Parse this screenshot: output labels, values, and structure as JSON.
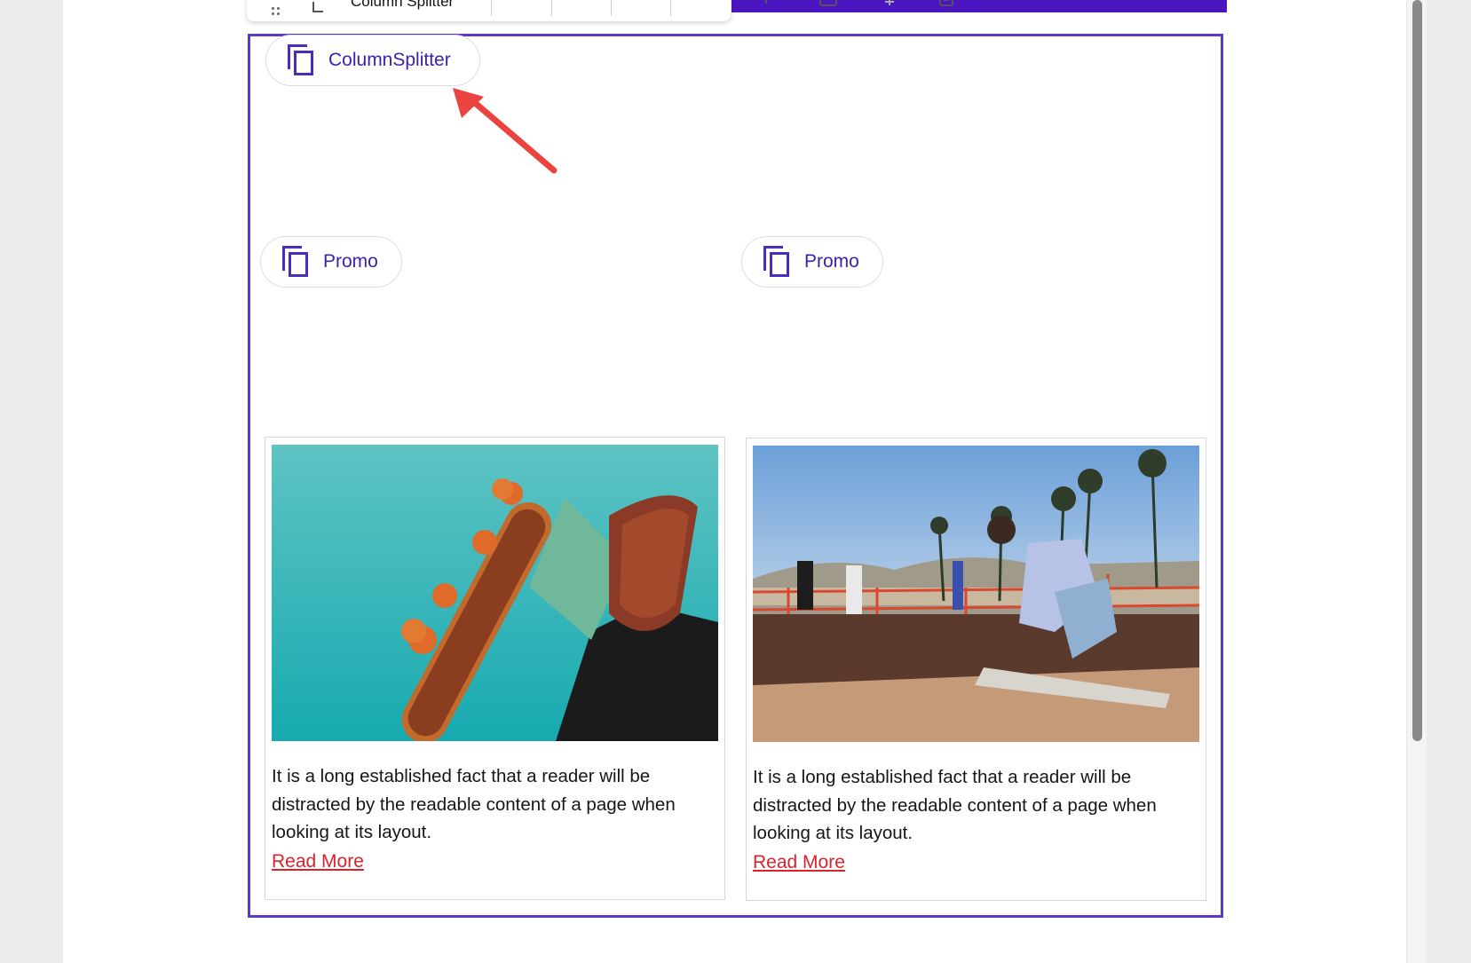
{
  "toolbar": {
    "title": "Column Splitter"
  },
  "components": {
    "column_splitter_label": "ColumnSplitter",
    "promo_left_label": "Promo",
    "promo_right_label": "Promo"
  },
  "cards": [
    {
      "text": "It is a long established fact that a reader will be distracted by the readable content of a page when looking at its layout.",
      "link": "Read More"
    },
    {
      "text": "It is a long established fact that a reader will be distracted by the readable content of a page when looking at its layout.",
      "link": "Read More"
    }
  ],
  "colors": {
    "accent": "#4b16c2",
    "selection_border": "#5a39c9",
    "link": "#d8232a",
    "annotation_arrow": "#e9443f"
  }
}
